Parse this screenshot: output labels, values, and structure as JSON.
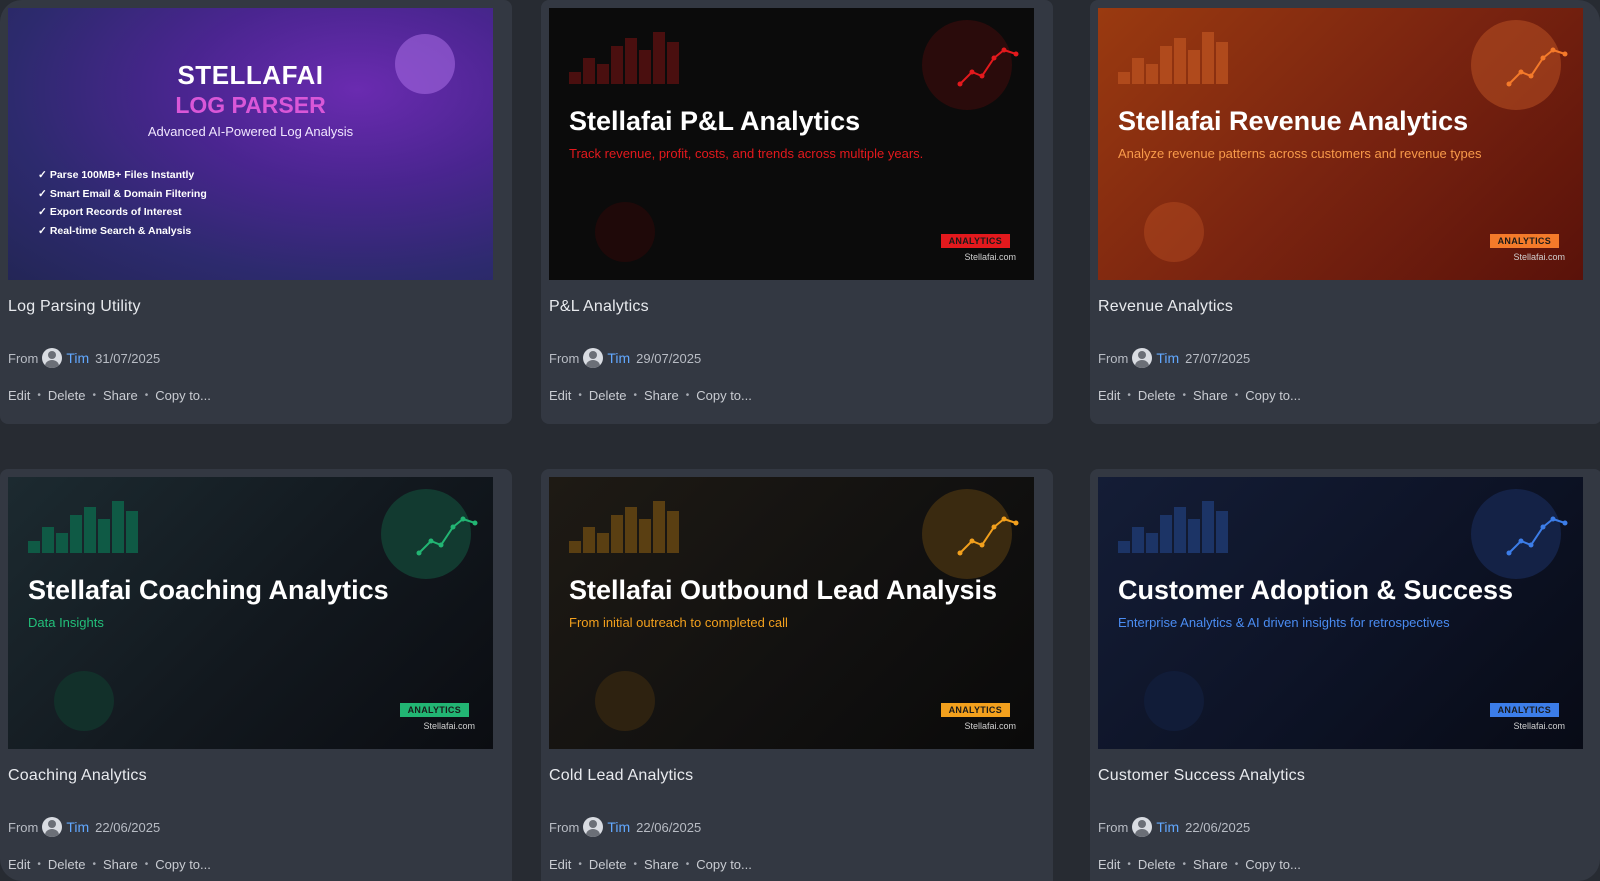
{
  "cards": [
    {
      "title": "Log Parsing Utility",
      "from_label": "From",
      "author": "Tim",
      "date": "31/07/2025",
      "thumb": {
        "brand": "STELLAFAI",
        "name": "LOG PARSER",
        "tagline": "Advanced AI-Powered Log Analysis",
        "features": [
          "Parse 100MB+ Files Instantly",
          "Smart Email & Domain Filtering",
          "Export Records of Interest",
          "Real-time Search & Analysis"
        ],
        "check": "✓"
      }
    },
    {
      "title": "P&L Analytics",
      "from_label": "From",
      "author": "Tim",
      "date": "29/07/2025",
      "thumb": {
        "heading": "Stellafai P&L Analytics",
        "subtitle": "Track revenue, profit, costs, and trends across multiple years.",
        "badge": "ANALYTICS",
        "site": "Stellafai.com",
        "accent": "#e3191d"
      }
    },
    {
      "title": "Revenue Analytics",
      "from_label": "From",
      "author": "Tim",
      "date": "27/07/2025",
      "thumb": {
        "heading": "Stellafai Revenue Analytics",
        "subtitle": "Analyze revenue patterns across customers and revenue types",
        "badge": "ANALYTICS",
        "site": "Stellafai.com",
        "accent": "#f47a2a"
      }
    },
    {
      "title": "Coaching Analytics",
      "from_label": "From",
      "author": "Tim",
      "date": "22/06/2025",
      "thumb": {
        "heading": "Stellafai Coaching Analytics",
        "subtitle": "Data Insights",
        "badge": "ANALYTICS",
        "site": "Stellafai.com",
        "accent": "#22b573"
      }
    },
    {
      "title": "Cold Lead Analytics",
      "from_label": "From",
      "author": "Tim",
      "date": "22/06/2025",
      "thumb": {
        "heading": "Stellafai Outbound Lead Analysis",
        "subtitle": "From initial outreach to completed call",
        "badge": "ANALYTICS",
        "site": "Stellafai.com",
        "accent": "#f2a01d"
      }
    },
    {
      "title": "Customer Success Analytics",
      "from_label": "From",
      "author": "Tim",
      "date": "22/06/2025",
      "thumb": {
        "heading": "Customer Adoption & Success",
        "subtitle": "Enterprise Analytics & AI driven insights for retrospectives",
        "badge": "ANALYTICS",
        "site": "Stellafai.com",
        "accent": "#3c7de8"
      }
    }
  ],
  "actions": {
    "edit": "Edit",
    "delete": "Delete",
    "share": "Share",
    "copy": "Copy to...",
    "separator": "•"
  }
}
